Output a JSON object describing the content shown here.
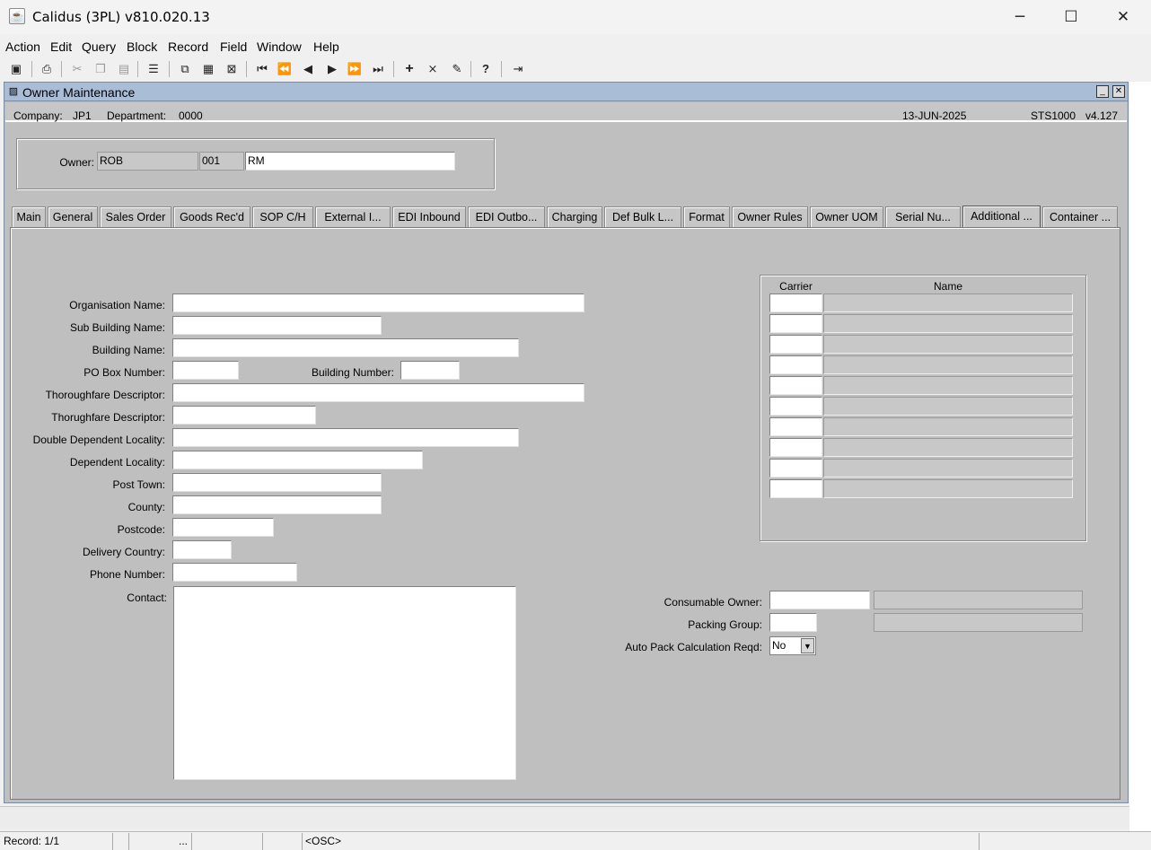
{
  "window": {
    "title": "Calidus (3PL) v810.020.13",
    "icon": "java-app-icon",
    "controls": [
      "minimize-icon",
      "maximize-icon",
      "close-icon"
    ]
  },
  "menu": [
    "Action",
    "Edit",
    "Query",
    "Block",
    "Record",
    "Field",
    "Window",
    "Help"
  ],
  "toolbar": {
    "buttons": [
      "save-icon",
      "print-icon",
      "cut-icon",
      "copy-icon",
      "paste-icon",
      "list-icon",
      "duplicate-icon",
      "copy-record-icon",
      "clear-icon",
      "first-record-icon",
      "prev-set-icon",
      "prev-record-icon",
      "next-record-icon",
      "next-set-icon",
      "last-record-icon",
      "insert-record-icon",
      "delete-record-icon",
      "edit-icon",
      "help-icon",
      "exit-icon"
    ]
  },
  "form": {
    "title": "Owner Maintenance",
    "company_label": "Company:",
    "company": "JP1",
    "department_label": "Department:",
    "department": "0000",
    "date": "13-JUN-2025",
    "form_code": "STS1000",
    "version": "v4.127"
  },
  "owner": {
    "label": "Owner:",
    "code": "ROB",
    "number": "001",
    "name": "RM"
  },
  "tabs": [
    "Main",
    "General",
    "Sales Order",
    "Goods Rec'd",
    "SOP C/H",
    "External I...",
    "EDI Inbound",
    "EDI Outbo...",
    "Charging",
    "Def Bulk L...",
    "Format",
    "Owner Rules",
    "Owner UOM",
    "Serial Nu...",
    "Additional ...",
    "Container ..."
  ],
  "active_tab": "Additional ...",
  "address": {
    "organisation_name": "Organisation Name:",
    "sub_building_name": "Sub Building Name:",
    "building_name": "Building Name:",
    "po_box_number": "PO Box Number:",
    "building_number": "Building Number:",
    "thoroughfare_descriptor_1": "Thoroughfare Descriptor:",
    "thoroughfare_descriptor_2": "Thorughfare Descriptor:",
    "double_dependent_locality": "Double Dependent Locality:",
    "dependent_locality": "Dependent Locality:",
    "post_town": "Post Town:",
    "county": "County:",
    "postcode": "Postcode:",
    "delivery_country": "Delivery Country:",
    "phone_number": "Phone Number:",
    "contact": "Contact:"
  },
  "carrier_table": {
    "columns": [
      "Carrier",
      "Name"
    ],
    "row_count_visible": 10
  },
  "misc": {
    "consumable_owner": "Consumable Owner:",
    "packing_group": "Packing Group:",
    "auto_pack_label": "Auto Pack Calculation Reqd:",
    "auto_pack_value": "No"
  },
  "status": {
    "record": "Record: 1/1",
    "ellipsis": "...",
    "mode": "<OSC>"
  }
}
